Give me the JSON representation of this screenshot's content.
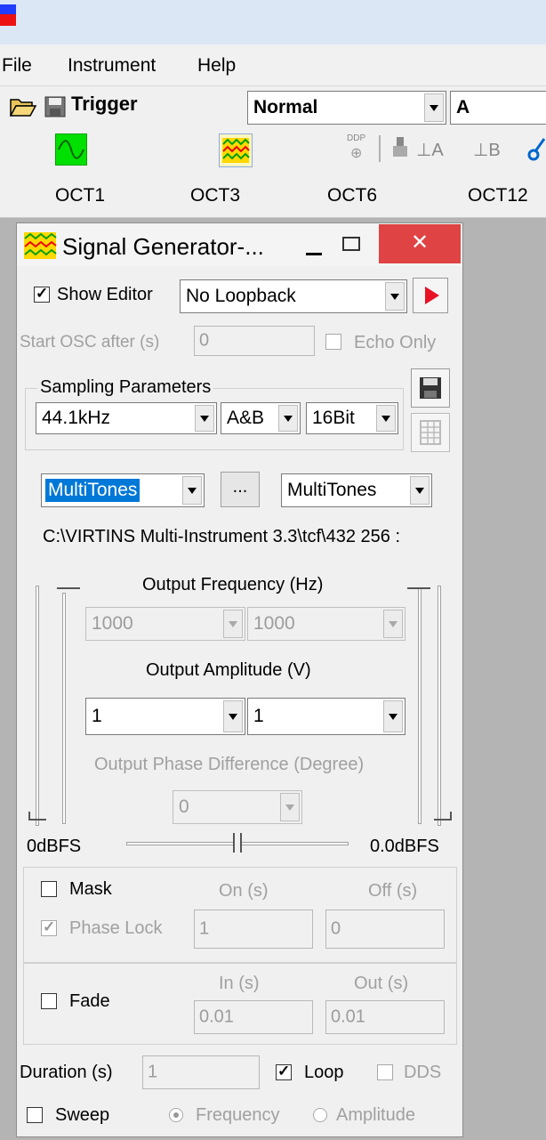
{
  "menu": {
    "file": "File",
    "instrument": "Instrument",
    "help": "Help"
  },
  "toolbar": {
    "trigger_label": "Trigger",
    "trigger_mode": "Normal",
    "trigger_source": "A",
    "ddp_label": "DDP",
    "probe_a": "⊥A",
    "probe_b": "⊥B"
  },
  "oct_tabs": [
    "OCT1",
    "OCT3",
    "OCT6",
    "OCT12"
  ],
  "panel": {
    "title": "Signal Generator-...",
    "show_editor_label": "Show Editor",
    "show_editor_checked": true,
    "loopback": "No Loopback",
    "start_osc_label": "Start OSC after (s)",
    "start_osc_value": "0",
    "echo_only_label": "Echo Only",
    "sampling_group": "Sampling Parameters",
    "sample_rate": "44.1kHz",
    "channels": "A&B",
    "bit_depth": "16Bit",
    "wave_type_a": "MultiTones",
    "more_button": "...",
    "wave_type_b": "MultiTones",
    "file_path": "C:\\VIRTINS Multi-Instrument 3.3\\tcf\\432  256 :",
    "output_frequency_label": "Output Frequency (Hz)",
    "freq_a": "1000",
    "freq_b": "1000",
    "output_amplitude_label": "Output Amplitude (V)",
    "amp_a": "1",
    "amp_b": "1",
    "phase_label": "Output Phase Difference (Degree)",
    "phase_value": "0",
    "left_level": "0dBFS",
    "right_level": "0.0dBFS",
    "mask_label": "Mask",
    "on_label": "On (s)",
    "off_label": "Off (s)",
    "phase_lock_label": "Phase Lock",
    "phase_lock_on": "1",
    "phase_lock_off": "0",
    "fade_label": "Fade",
    "in_label": "In (s)",
    "out_label": "Out (s)",
    "fade_in": "0.01",
    "fade_out": "0.01",
    "duration_label": "Duration (s)",
    "duration_value": "1",
    "loop_label": "Loop",
    "dds_label": "DDS",
    "sweep_label": "Sweep",
    "frequency_label": "Frequency",
    "amplitude_label": "Amplitude"
  },
  "colors": {
    "close_red": "#e04343",
    "play_red": "#e81123",
    "wave_green": "#00e000",
    "gen_yellow": "#ffd800"
  }
}
